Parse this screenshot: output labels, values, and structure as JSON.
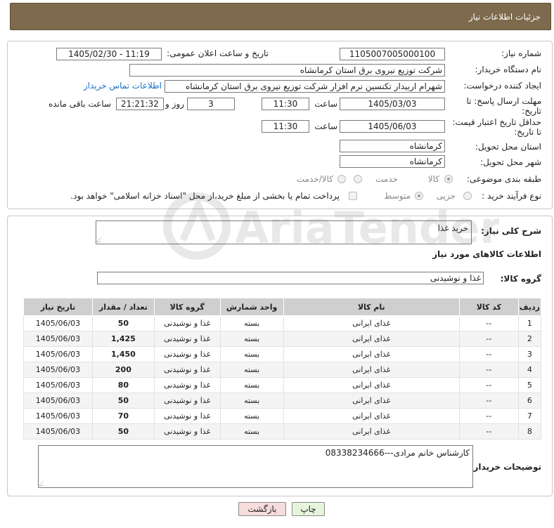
{
  "header": {
    "title": "جزئیات اطلاعات نیاز"
  },
  "form": {
    "need_number_label": "شماره نیاز:",
    "need_number": "1105007005000100",
    "announce_label": "تاریخ و ساعت اعلان عمومی:",
    "announce_value": "1405/02/30 - 11:19",
    "buyer_org_label": "نام دستگاه خریدار:",
    "buyer_org": "شرکت توزیع نیروی برق استان کرمانشاه",
    "creator_label": "ایجاد کننده درخواست:",
    "creator": "شهرام اربیدار تکنسین نرم افزار شرکت توزیع نیروی برق استان کرمانشاه",
    "contact_link": "اطلاعات تماس خریدار",
    "reply_deadline_label_1": "مهلت ارسال پاسخ: تا",
    "reply_deadline_label_2": "تاریخ:",
    "reply_date": "1405/03/03",
    "time_label": "ساعت",
    "reply_time": "11:30",
    "days": "3",
    "days_label": "روز و",
    "remaining": "21:21:32",
    "remaining_label": "ساعت باقی مانده",
    "price_validity_label_1": "حداقل تاریخ اعتبار قیمت:",
    "price_validity_label_2": "تا تاریخ:",
    "price_date": "1405/06/03",
    "price_time": "11:30",
    "province_label": "استان محل تحویل:",
    "province": "کرمانشاه",
    "city_label": "شهر محل تحویل:",
    "city": "کرمانشاه",
    "category_label": "طبقه بندی موضوعی:",
    "category_options": [
      "کالا",
      "خدمت",
      "کالا/خدمت"
    ],
    "process_label": "نوع فرآیند خرید :",
    "process_options": [
      "جزیی",
      "متوسط"
    ],
    "payment_note": "پرداخت تمام یا بخشی از مبلغ خرید،از محل \"اسناد خزانه اسلامی\" خواهد بود."
  },
  "details": {
    "summary_label": "شرح کلی نیاز:",
    "summary": "خرید غذا",
    "goods_info_title": "اطلاعات کالاهای مورد نیاز",
    "goods_group_label": "گروه کالا:",
    "goods_group": "غذا و نوشیدنی"
  },
  "table": {
    "headers": [
      "ردیف",
      "کد کالا",
      "نام کالا",
      "واحد شمارش",
      "گروه کالا",
      "تعداد / مقدار",
      "تاریخ نیاز"
    ],
    "rows": [
      [
        "1",
        "--",
        "غذای ایرانی",
        "بسته",
        "غذا و نوشیدنی",
        "50",
        "1405/06/03"
      ],
      [
        "2",
        "--",
        "غذای ایرانی",
        "بسته",
        "غذا و نوشیدنی",
        "1,425",
        "1405/06/03"
      ],
      [
        "3",
        "--",
        "غذای ایرانی",
        "بسته",
        "غذا و نوشیدنی",
        "1,450",
        "1405/06/03"
      ],
      [
        "4",
        "--",
        "غذای ایرانی",
        "بسته",
        "غذا و نوشیدنی",
        "200",
        "1405/06/03"
      ],
      [
        "5",
        "--",
        "غذای ایرانی",
        "بسته",
        "غذا و نوشیدنی",
        "80",
        "1405/06/03"
      ],
      [
        "6",
        "--",
        "غذای ایرانی",
        "بسته",
        "غذا و نوشیدنی",
        "50",
        "1405/06/03"
      ],
      [
        "7",
        "--",
        "غذای ایرانی",
        "بسته",
        "غذا و نوشیدنی",
        "70",
        "1405/06/03"
      ],
      [
        "8",
        "--",
        "غذای ایرانی",
        "بسته",
        "غذا و نوشیدنی",
        "50",
        "1405/06/03"
      ]
    ]
  },
  "buyer_notes": {
    "label": "توضیحات خریدار:",
    "text": "کارشناس خانم مرادی---08338234666"
  },
  "buttons": {
    "print": "چاپ",
    "back": "بازگشت"
  },
  "watermark": {
    "text": "AriaTender.net"
  },
  "colors": {
    "header_bg": "#7e6a4c",
    "link": "#1a6fc9",
    "back_button_bg": "#f7dcdc",
    "print_button_bg": "#e4f5dc"
  }
}
